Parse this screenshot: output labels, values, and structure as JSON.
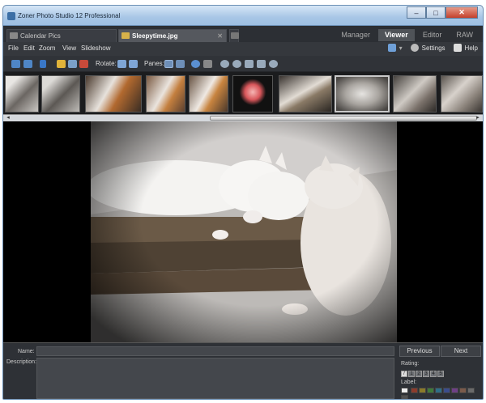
{
  "window": {
    "title": "Zoner Photo Studio 12 Professional",
    "min": "–",
    "max": "□",
    "close": "✕"
  },
  "doc_tabs": [
    {
      "label": "Calendar Pics"
    },
    {
      "label": "Sleepytime.jpg"
    }
  ],
  "mode_tabs": [
    "Manager",
    "Viewer",
    "Editor",
    "RAW"
  ],
  "menu": [
    "File",
    "Edit",
    "Zoom",
    "View",
    "Slideshow"
  ],
  "menu_right": {
    "settings": "Settings",
    "help": "Help"
  },
  "toolbar": {
    "rotate_label": "Rotate:",
    "panes_label": "Panes:"
  },
  "info": {
    "name_label": "Name:",
    "description_label": "Description:",
    "previous": "Previous",
    "next": "Next",
    "rating_label": "Rating:",
    "ratings": [
      "1",
      "2",
      "3",
      "4",
      "5"
    ],
    "label_label": "Label:",
    "label_colors": [
      "#8c3b2c",
      "#8a7a2a",
      "#3f7a3a",
      "#2f6e88",
      "#3b4d8c",
      "#6e3f86",
      "#7a5a4a",
      "#6a6a6a",
      "#505050"
    ]
  },
  "colors": {
    "accent": "#6b8fb5",
    "background": "#2b2d31",
    "close": "#c4402c"
  }
}
